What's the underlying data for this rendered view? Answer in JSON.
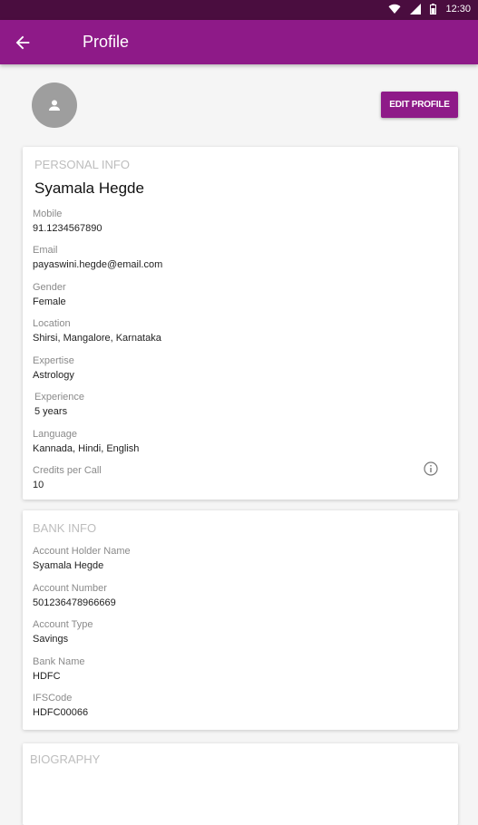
{
  "status": {
    "time": "12:30"
  },
  "appbar": {
    "title": "Profile"
  },
  "edit_button": "EDIT PROFILE",
  "personal": {
    "section_title": "PERSONAL INFO",
    "name": "Syamala Hegde",
    "fields": [
      {
        "label": "Mobile",
        "value": "91.1234567890"
      },
      {
        "label": "Email",
        "value": "payaswini.hegde@email.com"
      },
      {
        "label": "Gender",
        "value": "Female"
      },
      {
        "label": "Location",
        "value": "Shirsi, Mangalore, Karnataka"
      },
      {
        "label": "Expertise",
        "value": "Astrology"
      },
      {
        "label": "Experience",
        "value": "5 years"
      },
      {
        "label": "Language",
        "value": "Kannada, Hindi, English"
      },
      {
        "label": "Credits per Call",
        "value": "10"
      }
    ]
  },
  "bank": {
    "section_title": "BANK INFO",
    "fields": [
      {
        "label": "Account Holder Name",
        "value": "Syamala Hegde"
      },
      {
        "label": "Account Number",
        "value": "501236478966669"
      },
      {
        "label": "Account Type",
        "value": "Savings"
      },
      {
        "label": "Bank Name",
        "value": "HDFC"
      },
      {
        "label": "IFSCode",
        "value": "HDFC00066"
      }
    ]
  },
  "biography": {
    "section_title": "BIOGRAPHY"
  },
  "colors": {
    "primary": "#8e1a88",
    "status": "#4a0d3f"
  },
  "icons": [
    "wifi-icon",
    "signal-icon",
    "battery-icon",
    "back-arrow-icon",
    "person-icon",
    "info-icon"
  ]
}
